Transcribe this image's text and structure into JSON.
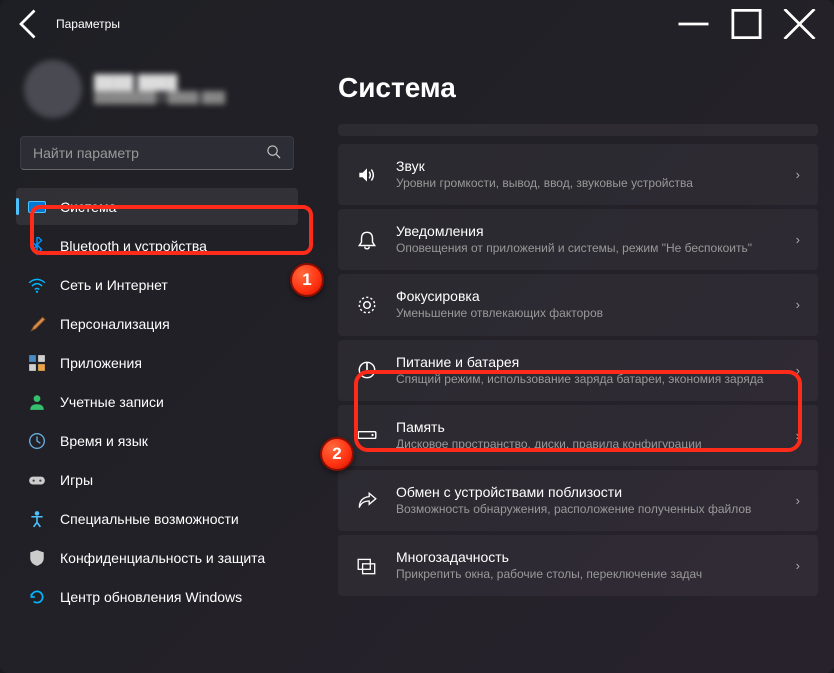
{
  "app_title": "Параметры",
  "profile": {
    "name": "████ ████",
    "email": "████████@████.███"
  },
  "search": {
    "placeholder": "Найти параметр"
  },
  "sidebar": {
    "items": [
      {
        "label": "Система",
        "active": true
      },
      {
        "label": "Bluetooth и устройства"
      },
      {
        "label": "Сеть и Интернет"
      },
      {
        "label": "Персонализация"
      },
      {
        "label": "Приложения"
      },
      {
        "label": "Учетные записи"
      },
      {
        "label": "Время и язык"
      },
      {
        "label": "Игры"
      },
      {
        "label": "Специальные возможности"
      },
      {
        "label": "Конфиденциальность и защита"
      },
      {
        "label": "Центр обновления Windows"
      }
    ]
  },
  "page": {
    "title": "Система",
    "items": [
      {
        "title": "Звук",
        "desc": "Уровни громкости, вывод, ввод, звуковые устройства"
      },
      {
        "title": "Уведомления",
        "desc": "Оповещения от приложений и системы, режим \"Не беспокоить\""
      },
      {
        "title": "Фокусировка",
        "desc": "Уменьшение отвлекающих факторов"
      },
      {
        "title": "Питание и батарея",
        "desc": "Спящий режим, использование заряда батареи, экономия заряда"
      },
      {
        "title": "Память",
        "desc": "Дисковое пространство, диски, правила конфигурации"
      },
      {
        "title": "Обмен с устройствами поблизости",
        "desc": "Возможность обнаружения, расположение полученных файлов"
      },
      {
        "title": "Многозадачность",
        "desc": "Прикрепить окна, рабочие столы, переключение задач"
      }
    ]
  },
  "markers": {
    "m1": "1",
    "m2": "2"
  }
}
